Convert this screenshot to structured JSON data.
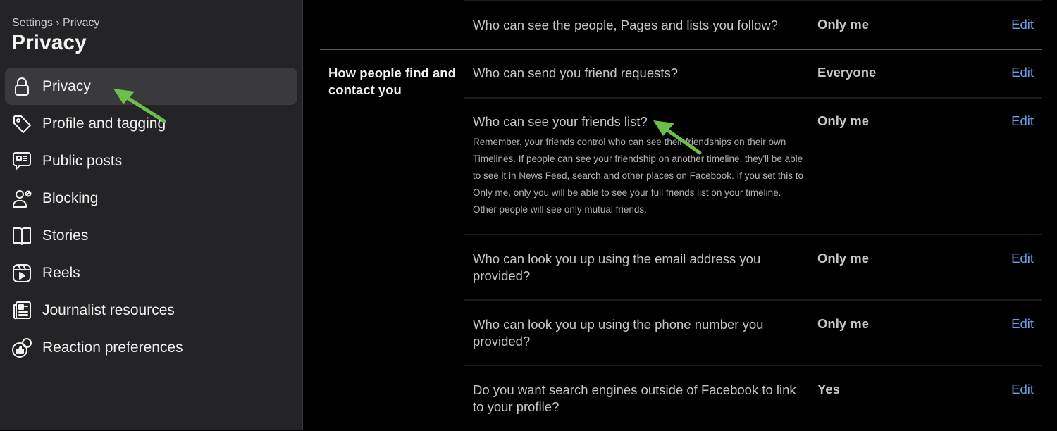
{
  "sidebar": {
    "breadcrumb": "Settings › Privacy",
    "title": "Privacy",
    "items": [
      {
        "label": "Privacy",
        "icon": "lock-icon",
        "active": true
      },
      {
        "label": "Profile and tagging",
        "icon": "tag-icon"
      },
      {
        "label": "Public posts",
        "icon": "speech-bubble-icon"
      },
      {
        "label": "Blocking",
        "icon": "person-block-icon"
      },
      {
        "label": "Stories",
        "icon": "book-icon"
      },
      {
        "label": "Reels",
        "icon": "reels-icon"
      },
      {
        "label": "Journalist resources",
        "icon": "newspaper-icon"
      },
      {
        "label": "Reaction preferences",
        "icon": "reaction-icon"
      }
    ]
  },
  "main": {
    "section_title": "How people find and contact you",
    "rows": [
      {
        "question": "Who can see the people, Pages and lists you follow?",
        "value": "Only me",
        "action": "Edit"
      },
      {
        "question": "Who can send you friend requests?",
        "value": "Everyone",
        "action": "Edit"
      },
      {
        "question": "Who can see your friends list?",
        "description": "Remember, your friends control who can see their friendships on their own Timelines. If people can see your friendship on another timeline, they'll be able to see it in News Feed, search and other places on Facebook. If you set this to Only me, only you will be able to see your full friends list on your timeline. Other people will see only mutual friends.",
        "value": "Only me",
        "action": "Edit"
      },
      {
        "question": "Who can look you up using the email address you provided?",
        "value": "Only me",
        "action": "Edit"
      },
      {
        "question": "Who can look you up using the phone number you provided?",
        "value": "Only me",
        "action": "Edit"
      },
      {
        "question": "Do you want search engines outside of Facebook to link to your profile?",
        "value": "Yes",
        "action": "Edit"
      }
    ]
  },
  "colors": {
    "accent_link": "#6b9fee",
    "annotation_arrow": "#6cc04a"
  }
}
